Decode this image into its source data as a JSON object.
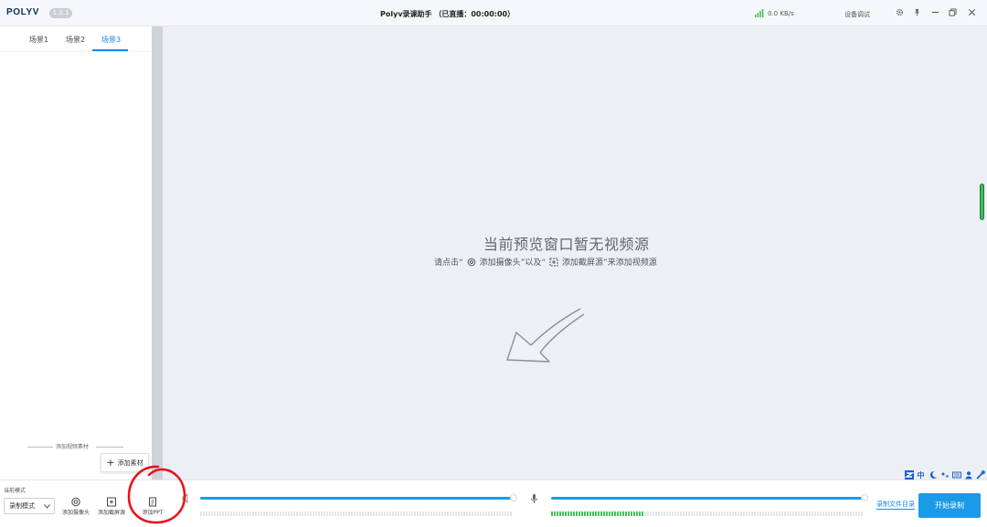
{
  "titlebar": {
    "logo": "POLYV",
    "version": "1.0.1",
    "title": "Polyv录课助手 （已直播：00:00:00）",
    "network_speed": "0.0 KB/s",
    "device_debug": "设备调试"
  },
  "scene_tabs": [
    {
      "label": "场景1",
      "active": false
    },
    {
      "label": "场景2",
      "active": false
    },
    {
      "label": "场景3",
      "active": true
    }
  ],
  "materials": {
    "section_label": "添加视频素材",
    "add_button": "添加素材"
  },
  "preview": {
    "title": "当前预览窗口暂无视频源",
    "hint_prefix": "请点击“",
    "hint_camera": "添加摄像头",
    "hint_mid": "”以及“",
    "hint_screen": "添加截屏源",
    "hint_suffix": "”来添加视频源"
  },
  "bottom": {
    "mode_label": "当前模式",
    "mode_value": "录制模式",
    "tools": [
      {
        "label": "添加摄像头",
        "icon": "camera-icon"
      },
      {
        "label": "添加截屏源",
        "icon": "screen-capture-icon"
      },
      {
        "label": "添加PPT",
        "icon": "ppt-icon"
      }
    ],
    "speaker_level": 1.0,
    "mic_level": 1.0,
    "mic_meter_level": 0.3,
    "record_dir": "录制文件目录",
    "start_button": "开始录制"
  },
  "ime": {
    "lang": "中",
    "icons": [
      "sogou-logo-icon",
      "moon-icon",
      "punctuation-icon",
      "keyboard-icon",
      "user-icon",
      "wrench-icon"
    ]
  },
  "colors": {
    "accent": "#1b9ae8",
    "tab_active": "#1b84e8",
    "meter_on": "#46c25a",
    "annotation": "#e8141c"
  }
}
